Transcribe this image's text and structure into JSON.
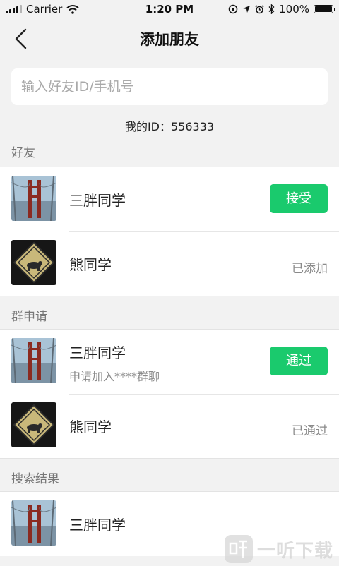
{
  "status_bar": {
    "carrier": "Carrier",
    "time": "1:20 PM",
    "battery": "100%"
  },
  "nav": {
    "title": "添加朋友"
  },
  "search": {
    "placeholder": "输入好友ID/手机号"
  },
  "my_id": "我的ID：556333",
  "sections": {
    "friends": {
      "header": "好友",
      "items": [
        {
          "name": "三胖同学",
          "action": "接受"
        },
        {
          "name": "熊同学",
          "status": "已添加"
        }
      ]
    },
    "group_requests": {
      "header": "群申请",
      "items": [
        {
          "name": "三胖同学",
          "subtext": "申请加入****群聊",
          "action": "通过"
        },
        {
          "name": "熊同学",
          "status": "已通过"
        }
      ]
    },
    "search_results": {
      "header": "搜索结果",
      "items": [
        {
          "name": "三胖同学"
        }
      ]
    }
  },
  "colors": {
    "accent": "#1aca6d",
    "background": "#f2f2f2"
  },
  "watermark": {
    "text": "一听下载",
    "logo_text": "听"
  }
}
